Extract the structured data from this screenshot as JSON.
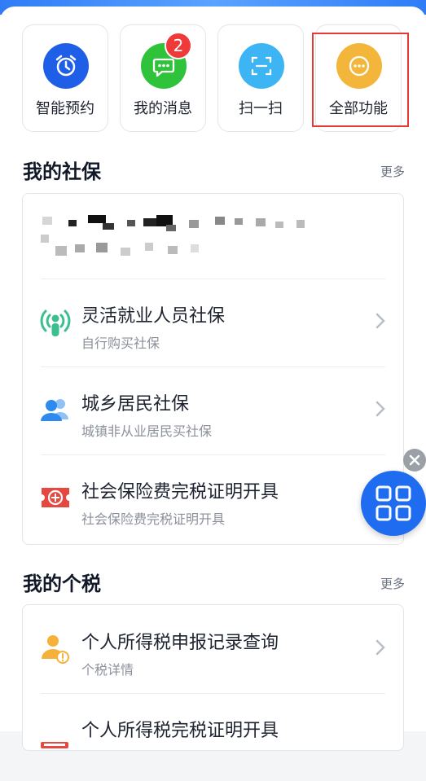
{
  "quick_actions": [
    {
      "label": "智能预约",
      "icon": "alarm-clock-icon",
      "color": "#1f5fe8"
    },
    {
      "label": "我的消息",
      "icon": "chat-bubble-icon",
      "color": "#2ec33a",
      "badge": "2"
    },
    {
      "label": "扫一扫",
      "icon": "scan-icon",
      "color": "#3db5f5"
    },
    {
      "label": "全部功能",
      "icon": "more-dots-icon",
      "color": "#f3b63a"
    }
  ],
  "social_security": {
    "title": "我的社保",
    "more": "更多",
    "items": [
      {
        "title": "灵活就业人员社保",
        "subtitle": "自行购买社保",
        "icon": "person-signal-icon"
      },
      {
        "title": "城乡居民社保",
        "subtitle": "城镇非从业居民买社保",
        "icon": "users-icon"
      },
      {
        "title": "社会保险费完税证明开具",
        "subtitle": "社会保险费完税证明开具",
        "icon": "si-ticket-icon"
      }
    ]
  },
  "personal_tax": {
    "title": "我的个税",
    "more": "更多",
    "items": [
      {
        "title": "个人所得税申报记录查询",
        "subtitle": "个税详情",
        "icon": "person-alert-icon"
      },
      {
        "title": "个人所得税完税证明开具",
        "icon": "receipt-icon"
      }
    ]
  },
  "colors": {
    "accent": "#1f6cf0",
    "highlight": "#e53935"
  }
}
